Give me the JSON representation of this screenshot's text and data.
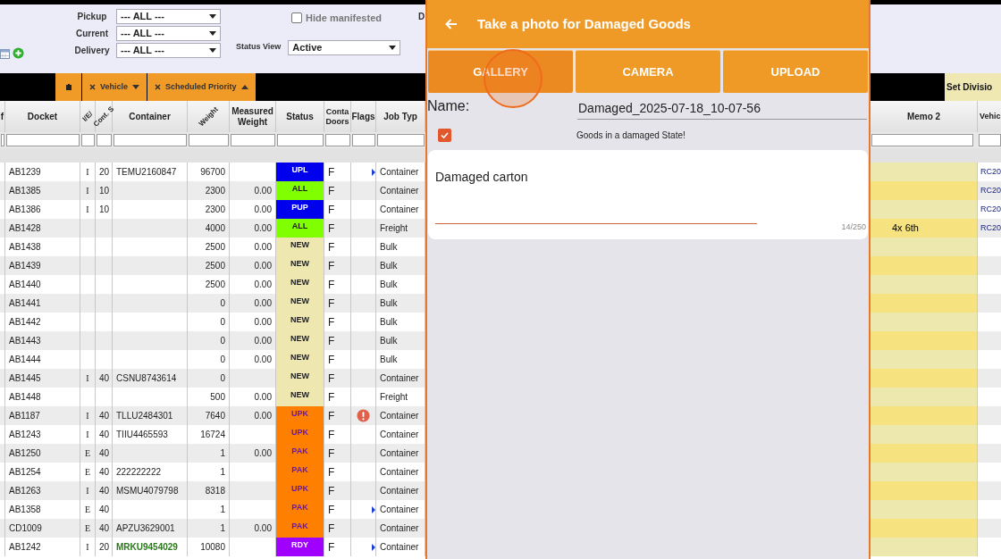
{
  "top_cut_label": "D",
  "filters": [
    {
      "label": "Pickup",
      "value": "--- ALL ---"
    },
    {
      "label": "Current",
      "value": "--- ALL ---"
    },
    {
      "label": "Delivery",
      "value": "--- ALL ---"
    }
  ],
  "hide_manifested": {
    "label": "Hide manifested",
    "checked": false
  },
  "status_view": {
    "label": "Status View",
    "value": "Active"
  },
  "toolbar": [
    {
      "kind": "icon"
    },
    {
      "kind": "sort",
      "label": "Vehicle",
      "ascending": false
    },
    {
      "kind": "sort",
      "label": "Scheduled Priority",
      "ascending": true
    }
  ],
  "set_division": "Set Divisio",
  "columns": [
    {
      "label": "f",
      "rotated": false
    },
    {
      "label": "Docket",
      "rotated": false
    },
    {
      "label": "I/E/",
      "rotated": true
    },
    {
      "label": "Cont. S",
      "rotated": true
    },
    {
      "label": "Container",
      "rotated": false
    },
    {
      "label": "Weight",
      "rotated": true
    },
    {
      "label": "Measured Weight",
      "rotated": false
    },
    {
      "label": "Status",
      "rotated": false
    },
    {
      "label": "Conta Doors",
      "rotated": false
    },
    {
      "label": "Flags",
      "rotated": false
    },
    {
      "label": "Job Typ",
      "rotated": false
    }
  ],
  "right_columns": [
    {
      "label": "Memo 2"
    },
    {
      "label": "Vehic"
    }
  ],
  "rows": [
    {
      "docket": "AB1239",
      "ie": "I",
      "size": "20",
      "container": {
        "text": "TEMU2160847",
        "highlight": false
      },
      "weight": "96700",
      "status": {
        "code": "UPL",
        "color": "#0000ee"
      },
      "doors": "F",
      "flags": [
        {
          "kind": "arrow"
        }
      ],
      "job_type": "Container",
      "vehicle": "RC20"
    },
    {
      "docket": "AB1385",
      "ie": "I",
      "size": "10",
      "weight": "2300",
      "measured": "0.00",
      "status": {
        "code": "ALL",
        "color": "#80ff00"
      },
      "doors": "F",
      "job_type": "Container",
      "vehicle": "RC20"
    },
    {
      "docket": "AB1386",
      "ie": "I",
      "size": "10",
      "weight": "2300",
      "measured": "0.00",
      "status": {
        "code": "PUP",
        "color": "#0000ee"
      },
      "doors": "F",
      "job_type": "Container",
      "vehicle": "RC20"
    },
    {
      "docket": "AB1428",
      "weight": "4000",
      "measured": "0.00",
      "status": {
        "code": "ALL",
        "color": "#80ff00"
      },
      "doors": "F",
      "job_type": "Freight",
      "memo2": "4x 6th",
      "vehicle": "RC20"
    },
    {
      "docket": "AB1438",
      "weight": "2500",
      "measured": "0.00",
      "status": {
        "code": "NEW",
        "color": "#eee8b0"
      },
      "doors": "F",
      "job_type": "Bulk"
    },
    {
      "docket": "AB1439",
      "weight": "2500",
      "measured": "0.00",
      "status": {
        "code": "NEW",
        "color": "#eee8b0"
      },
      "doors": "F",
      "job_type": "Bulk"
    },
    {
      "docket": "AB1440",
      "weight": "2500",
      "measured": "0.00",
      "status": {
        "code": "NEW",
        "color": "#eee8b0"
      },
      "doors": "F",
      "job_type": "Bulk"
    },
    {
      "docket": "AB1441",
      "weight": "0",
      "measured": "0.00",
      "status": {
        "code": "NEW",
        "color": "#eee8b0"
      },
      "doors": "F",
      "job_type": "Bulk"
    },
    {
      "docket": "AB1442",
      "weight": "0",
      "measured": "0.00",
      "status": {
        "code": "NEW",
        "color": "#eee8b0"
      },
      "doors": "F",
      "job_type": "Bulk"
    },
    {
      "docket": "AB1443",
      "weight": "0",
      "measured": "0.00",
      "status": {
        "code": "NEW",
        "color": "#eee8b0"
      },
      "doors": "F",
      "job_type": "Bulk"
    },
    {
      "docket": "AB1444",
      "weight": "0",
      "measured": "0.00",
      "status": {
        "code": "NEW",
        "color": "#eee8b0"
      },
      "doors": "F",
      "job_type": "Bulk"
    },
    {
      "docket": "AB1445",
      "ie": "I",
      "size": "40",
      "container": {
        "text": "CSNU8743614",
        "highlight": false
      },
      "weight": "0",
      "status": {
        "code": "NEW",
        "color": "#eee8b0"
      },
      "doors": "F",
      "job_type": "Container"
    },
    {
      "docket": "AB1448",
      "weight": "500",
      "measured": "0.00",
      "status": {
        "code": "NEW",
        "color": "#eee8b0"
      },
      "doors": "F",
      "job_type": "Freight"
    },
    {
      "docket": "AB1187",
      "ie": "I",
      "size": "40",
      "container": {
        "text": "TLLU2484301",
        "highlight": false
      },
      "weight": "7640",
      "measured": "0.00",
      "status": {
        "code": "UPK",
        "color": "#ff8000"
      },
      "doors": "F",
      "flags": [
        {
          "kind": "alert"
        }
      ],
      "job_type": "Container"
    },
    {
      "docket": "AB1243",
      "ie": "I",
      "size": "40",
      "container": {
        "text": "TIIU4465593",
        "highlight": false
      },
      "weight": "16724",
      "status": {
        "code": "UPK",
        "color": "#ff8000"
      },
      "doors": "F",
      "job_type": "Container"
    },
    {
      "docket": "AB1250",
      "ie": "E",
      "size": "40",
      "weight": "1",
      "measured": "0.00",
      "status": {
        "code": "PAK",
        "color": "#ff8000"
      },
      "doors": "F",
      "job_type": "Container"
    },
    {
      "docket": "AB1254",
      "ie": "E",
      "size": "40",
      "container": {
        "text": "222222222",
        "highlight": false
      },
      "weight": "1",
      "status": {
        "code": "PAK",
        "color": "#ff8000"
      },
      "doors": "F",
      "job_type": "Container"
    },
    {
      "docket": "AB1263",
      "ie": "I",
      "size": "40",
      "container": {
        "text": "MSMU4079798",
        "highlight": false
      },
      "weight": "8318",
      "status": {
        "code": "UPK",
        "color": "#ff8000"
      },
      "doors": "F",
      "job_type": "Container"
    },
    {
      "docket": "AB1358",
      "ie": "E",
      "size": "40",
      "weight": "1",
      "status": {
        "code": "PAK",
        "color": "#ff8000"
      },
      "doors": "F",
      "flags": [
        {
          "kind": "arrow"
        }
      ],
      "job_type": "Container"
    },
    {
      "docket": "CD1009",
      "ie": "E",
      "size": "40",
      "container": {
        "text": "APZU3629001",
        "highlight": false
      },
      "weight": "1",
      "measured": "0.00",
      "status": {
        "code": "PAK",
        "color": "#ff8000"
      },
      "doors": "F",
      "job_type": "Container"
    },
    {
      "docket": "AB1242",
      "ie": "I",
      "size": "20",
      "container": {
        "text": "MRKU9454029",
        "highlight": true
      },
      "weight": "10080",
      "status": {
        "code": "RDY",
        "color": "#a000ff"
      },
      "doors": "F",
      "flags": [
        {
          "kind": "arrow"
        }
      ],
      "job_type": "Container"
    }
  ],
  "modal": {
    "title": "Take a photo for Damaged Goods",
    "buttons": [
      {
        "label": "GALLERY",
        "pressed": true
      },
      {
        "label": "CAMERA",
        "pressed": false
      },
      {
        "label": "UPLOAD",
        "pressed": false
      }
    ],
    "name_label": "Name:",
    "name_value": "Damaged_2025-07-18_10-07-56",
    "checkbox": {
      "label": "Goods in a damaged State!",
      "checked": true
    },
    "note": {
      "value": "Damaged carton",
      "counter": "14/250"
    }
  }
}
